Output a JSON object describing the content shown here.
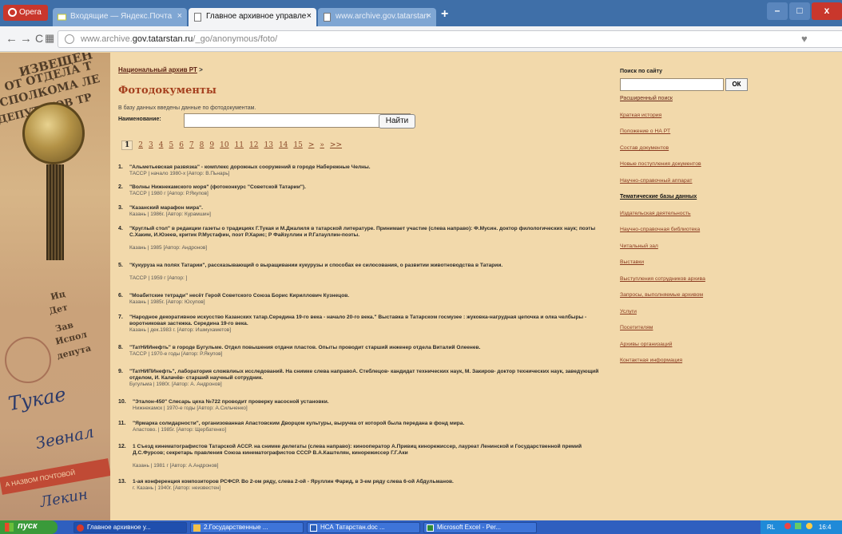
{
  "browser": {
    "opera_label": "Opera",
    "tabs": [
      {
        "label": "Входящие — Яндекс.Почта",
        "active": false
      },
      {
        "label": "Главное архивное управле",
        "active": true
      },
      {
        "label": "www.archive.gov.tatarstan",
        "active": false
      }
    ],
    "tab_plus": "+",
    "tab_close": "×",
    "url_prefix": "www.archive.",
    "url_domain": "gov.tatarstan.ru",
    "url_path": "/_go/anonymous/foto/",
    "min_label": "–",
    "max_label": "□",
    "close_label": "x"
  },
  "collage": {
    "lines": [
      "ИЗВЕЩЕН",
      "ОТ ОТДЕЛА Т",
      "СПОЛКОМА ЛЕ",
      "ДЕПУТАТОВ ТР",
      "Иц",
      "Дет",
      "Зав",
      "Испол",
      "депута"
    ],
    "script1": "Тукае",
    "script2": "Зевнал",
    "script3": "Лекин",
    "strip": "А НАЗВОМ ПОЧТОВОЙ"
  },
  "main": {
    "breadcrumb_link": "Национальный архив РТ",
    "breadcrumb_sep": ">",
    "title": "Фотодокументы",
    "intro": "В базу данных введены данные по фотодокументам.",
    "name_label": "Наименование:",
    "find_button": "Найти",
    "pages": [
      "1",
      "2",
      "3",
      "4",
      "5",
      "6",
      "7",
      "8",
      "9",
      "10",
      "11",
      "12",
      "13",
      "14",
      "15",
      ">",
      "»",
      ">>"
    ],
    "records": [
      {
        "num": "1.",
        "title": "\"Альметьевская развязка\" - комплекс дорожных сооружений в городе Набережные Челны.",
        "meta": "ТАССР | начало 1980-х [Автор: В.Пьнарь]"
      },
      {
        "num": "2.",
        "title": "\"Волны Нижнекамского моря\" (фотоконкурс \"Советской Татарии\").",
        "meta": "ТАССР | 1980 г [Автор: Р.Якупов]"
      },
      {
        "num": "3.",
        "title": "\"Казанский марафон мира\".",
        "meta": "Казань | 1986г. [Автор: Курамшин]"
      },
      {
        "num": "4.",
        "title": "\"Круглый стол\" в редакции газеты о традициях Г.Тукая и М.Джалиля в татарской литературе. Принимает участие (слева направо): Ф.Мусин. доктор филологических наук; поэты С.Хаким, И.Юзеев, критик Р.Мустафин, поэт Р.Харис; Р Файзуллин и Р.Гатауллин-поэты.",
        "meta": "Казань | 1985 [Автор: Андронов]"
      },
      {
        "num": "5.",
        "title": "\"Кукуруза на полях Татарии\", рассказывающий о выращивании кукурузы и способах ее силосования, о развитии животноводства в Татарии.",
        "meta": "ТАССР | 1959 г [Автор: ]"
      },
      {
        "num": "6.",
        "title": "\"Моабитские тетради\" несёт Герой Советского Союза Борис Кириллович Кузнецов.",
        "meta": "Казань | 1985г. [Автор: Юсупов]"
      },
      {
        "num": "7.",
        "title": "\"Народное декоративное искусство Казанских татар.Середина 19-го века - начало 20-го века.\" Выставка в Татарском госмузее : жуковка-нагрудная цепочка и олка челбыры - воротниковая застежка. Середина 19-го века.",
        "meta": "Казань | дек.1983 г. [Автор: Ишмухаметов]"
      },
      {
        "num": "8.",
        "title": "\"ТатНИИнефть\" в городе Бугульме. Отдел повышения отдачи пластов. Опыты проводит старший инженер отдела Виталий Олеенев.",
        "meta": "ТАССР | 1970-е годы [Автор: Р.Якупов]"
      },
      {
        "num": "9.",
        "title": "\"ТатНИПИнефть\", лаборатория сложвлиых исследований. На снимке слева направоА. Стеблецов- кандидат технических наук, М. Закиров- доктор технических наук, заведующий отделом, И. Калачёв- старший научный сотрудник.",
        "meta": "Бугульма | 1980г. [Автор: А. Андронов]"
      },
      {
        "num": "10.",
        "title": "\"Эталон-450\" Слесарь цеха №722 проводит проверку насосной установки.",
        "meta": "Нижнекамск | 1970-е годы [Автор: А.Сильченко]"
      },
      {
        "num": "11.",
        "title": "\"Ярмарка солидарности\", организованная Апастовским Дворцом культуры, выручка от которой была передана в фонд мира.",
        "meta": "Апастово. | 1985г. [Автор: Щербатенко]"
      },
      {
        "num": "12.",
        "title": "1 Съезд кинематографистов Татарской АССР. на снимке делегаты (слева направо): кинооператор А.Привиц кинорежиссер, лауреат Ленинской и Государственной премий Д.С.Фурсов; секретарь правления Союза кинематографистов СССР В.А.Каштелян, кинорежиссер Г.Г.Аки",
        "meta": "Казань | 1981 г [Автор: А.Андронов]"
      },
      {
        "num": "13.",
        "title": "1-ая конференция композиторов РСФСР. Во 2-ом ряду, слева 2-ой - Яруллин Фарид, в 3-ем ряду слева 6-ой Абдульманов.",
        "meta": "г. Казань | 1940г. [Автор: неизвестен]"
      }
    ]
  },
  "sidebar": {
    "search_label": "Поиск по сайту",
    "ok_button": "ОК",
    "advanced_link": "Расширенный поиск",
    "links": [
      {
        "label": "Краткая история",
        "current": false
      },
      {
        "label": "Положение о НА РТ",
        "current": false
      },
      {
        "label": "Состав документов",
        "current": false
      },
      {
        "label": "Новые поступления документов",
        "current": false
      },
      {
        "label": "Научно-справочный аппарат",
        "current": false
      },
      {
        "label": "Тематические базы данных",
        "current": true
      },
      {
        "label": "Издательская деятельность",
        "current": false
      },
      {
        "label": "Научно-справочная библиотека",
        "current": false
      },
      {
        "label": "Читальный зал",
        "current": false
      },
      {
        "label": "Выставки",
        "current": false
      },
      {
        "label": "Выступления сотрудников архива",
        "current": false
      },
      {
        "label": "Запросы, выполняемые архивом",
        "current": false
      },
      {
        "label": "Услуги",
        "current": false
      },
      {
        "label": "Посетителям",
        "current": false
      },
      {
        "label": "Архивы организаций",
        "current": false
      },
      {
        "label": "Контактная информация",
        "current": false
      }
    ]
  },
  "taskbar": {
    "start": "пуск",
    "tasks": [
      {
        "label": "Главное архивное у...",
        "color": "#d6392a"
      },
      {
        "label": "2.Государственные ...",
        "color": "#f2c14a"
      },
      {
        "label": "НСА Татарстан.doc ...",
        "color": "#2b5fb8"
      },
      {
        "label": "Microsoft Excel - Per...",
        "color": "#2e8a3a"
      }
    ],
    "tray": "RL",
    "clock": "16:4"
  },
  "colors": {
    "page_bg": "#f2d9ab",
    "title": "#a5401f",
    "link": "#8a3a20",
    "tabbar": "#3f6fa8"
  }
}
